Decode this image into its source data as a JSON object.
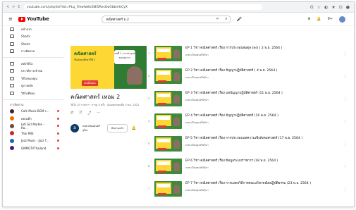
{
  "browser": {
    "nav_icons": [
      "<",
      ">",
      "C"
    ],
    "url": "youtube.com/playlist?list=PLq_7ihwfw8vEl8l5ResGw5bbmUCyX",
    "ext_icons": [
      "G",
      "☆",
      "◐",
      "★",
      "⊡",
      "●"
    ]
  },
  "header": {
    "logo_text": "YouTube",
    "search_value": "คณิตศาสตร์ ม.2",
    "clear": "✕",
    "search_icon": "⌕",
    "mic_icon": "🎤",
    "right_icons": [
      "⊕",
      "🔔"
    ],
    "notif_badge": "9+"
  },
  "sidebar": {
    "main_items": [
      {
        "label": "หน้าแรก"
      },
      {
        "label": "Shorts"
      },
      {
        "label": "Shorts"
      },
      {
        "label": "การติดตาม"
      }
    ],
    "library_items": [
      {
        "label": "คลังวิดีโอ"
      },
      {
        "label": "ประวัติการเข้าชม"
      },
      {
        "label": "วิดีโอของคุณ"
      },
      {
        "label": "ดูภายหลัง"
      },
      {
        "label": "วิดีโอที่ชอบ"
      }
    ],
    "subs_heading": "การติดตาม",
    "subs": [
      {
        "label": "Cafe Music BGM c...",
        "color": "#3e2723"
      },
      {
        "label": "เพลงเด็ก",
        "color": "#ef6c00"
      },
      {
        "label": "Lofi Girl Marble - Ha...",
        "color": "#6d4c41"
      },
      {
        "label": "Thai PBS",
        "color": "#c62828"
      },
      {
        "label": "Jazz Music - Jazz T...",
        "color": "#1565c0"
      },
      {
        "label": "GMMGTVThailand",
        "color": "#4a148c"
      }
    ]
  },
  "playlist": {
    "thumb_title": "คณิตศาสตร์",
    "thumb_sub": "ชั้นมัธยมศึกษาปีที่ 2",
    "thumb_bubble": "บทที่ 1 การประยุกต์ของสมการ",
    "thumb_tag": "เล่นทั้งหมด",
    "title": "คณิตศาสตร์ เทอม 2",
    "meta": "วิดีโอ 20 รายการ · การดู 0 ครั้ง · อัปเดตล่าสุดเมื่อ 3 พ.ย. 2022",
    "actions": [
      "⇄",
      "⤮",
      "⤴",
      "⋯"
    ],
    "owner_initial": "a",
    "owner_name": "ลงทะเบียนทุนศรีสุริยา",
    "subscribe_label": "ติดตามแล้ว",
    "bell": "🔔"
  },
  "videos": [
    {
      "num": "1",
      "title": "EP 1 วิชา คณิตศาสตร์ เรื่อง การประกอบสมดุล (ลง) ( 2 พ.ย. 2564 )",
      "channel": "ลงทะเบียนทุนศรีสุริยา"
    },
    {
      "num": "2",
      "title": "EP 2 วิชา คณิตศาสตร์ เรื่อง ปัญญาปฏิบัติศาสตร์ ( 4 พ.ย. 2564 )",
      "channel": "ลงทะเบียนทุนศรีสุริยา"
    },
    {
      "num": "3",
      "title": "EP 3 วิชา คณิตศาสตร์ เรื่อง บทปัญญาปฏิบัติศาสตร์ (11 พ.ย. 2564 )",
      "channel": "ลงทะเบียนทุนศรีสุริยา"
    },
    {
      "num": "4",
      "title": "EP 4 วิชา คณิตศาสตร์ เรื่อง ปัญญาปฏิบัติศาสตร์ (16 พ.ย. 2564 )",
      "channel": "ลงทะเบียนทุนศรีสุริยา"
    },
    {
      "num": "5",
      "title": "EP 5 วิชา คณิตศาสตร์ เรื่อง การประกอบบทความเชิงสังคมศาสตร์ (17 พ.ย. 2564 )",
      "channel": "ลงทะเบียนทุนศรีสุริยา"
    },
    {
      "num": "6",
      "title": "EP 6 วิชา คณิตศาสตร์ เรื่อง ข้อมูลระบบราชการ (18 พ.ย. 2564 )",
      "channel": "ลงทะเบียนทุนศรีสุริยา"
    },
    {
      "num": "7",
      "title": "EP 7 วิชา คณิตศาสตร์ เรื่อง การแสดงวิธีการต่อแนวิชาคณิตปฏิบัติธรรม (23 พ.ย. 2564 )",
      "channel": "ลงทะเบียนทุนศรีสุริยา"
    }
  ],
  "video_more_icon": "⋮"
}
